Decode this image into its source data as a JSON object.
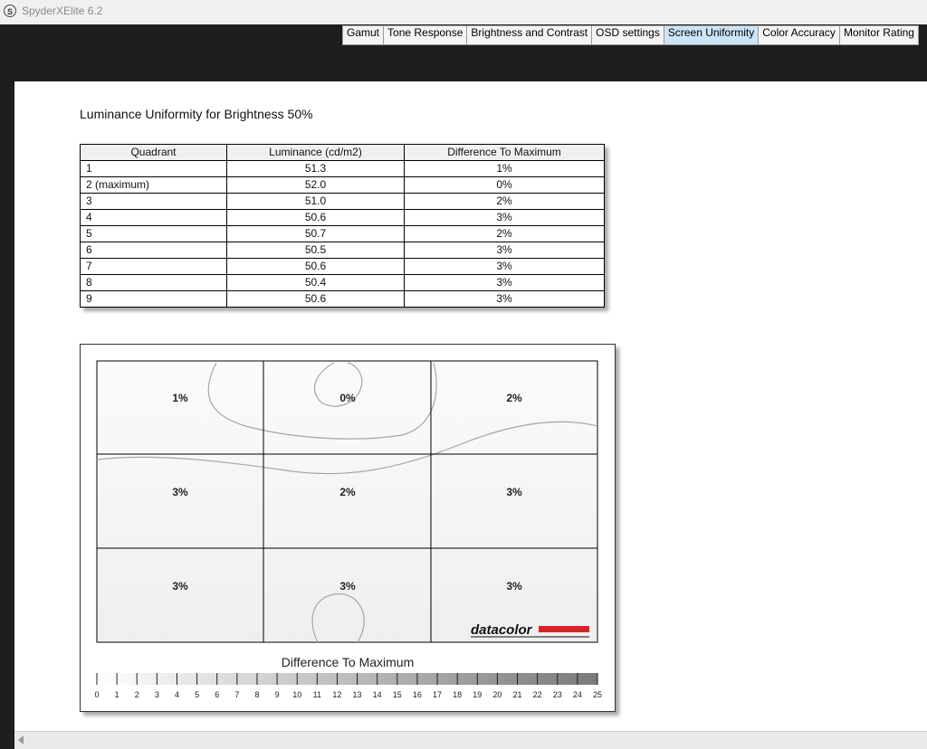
{
  "window": {
    "title": "SpyderXElite 6.2",
    "logo_letter": "S"
  },
  "tabs": [
    {
      "label": "Gamut",
      "active": false
    },
    {
      "label": "Tone Response",
      "active": false
    },
    {
      "label": "Brightness and Contrast",
      "active": false
    },
    {
      "label": "OSD settings",
      "active": false
    },
    {
      "label": "Screen Uniformity",
      "active": true
    },
    {
      "label": "Color Accuracy",
      "active": false
    },
    {
      "label": "Monitor Rating",
      "active": false
    }
  ],
  "report": {
    "title": "Luminance Uniformity for Brightness 50%",
    "table": {
      "headers": [
        "Quadrant",
        "Luminance (cd/m2)",
        "Difference To Maximum"
      ],
      "rows": [
        [
          "1",
          "51.3",
          "1%"
        ],
        [
          "2 (maximum)",
          "52.0",
          "0%"
        ],
        [
          "3",
          "51.0",
          "2%"
        ],
        [
          "4",
          "50.6",
          "3%"
        ],
        [
          "5",
          "50.7",
          "2%"
        ],
        [
          "6",
          "50.5",
          "3%"
        ],
        [
          "7",
          "50.6",
          "3%"
        ],
        [
          "8",
          "50.4",
          "3%"
        ],
        [
          "9",
          "50.6",
          "3%"
        ]
      ]
    }
  },
  "uniformity_map": {
    "grid_labels": [
      "1%",
      "0%",
      "2%",
      "3%",
      "2%",
      "3%",
      "3%",
      "3%",
      "3%"
    ],
    "brand_logo": "datacolor",
    "brand_color": "#e31e24",
    "scale_title": "Difference To Maximum",
    "scale_ticks": [
      "0",
      "1",
      "2",
      "3",
      "4",
      "5",
      "6",
      "7",
      "8",
      "9",
      "10",
      "11",
      "12",
      "13",
      "14",
      "15",
      "16",
      "17",
      "18",
      "19",
      "20",
      "21",
      "22",
      "23",
      "24",
      "25"
    ]
  }
}
